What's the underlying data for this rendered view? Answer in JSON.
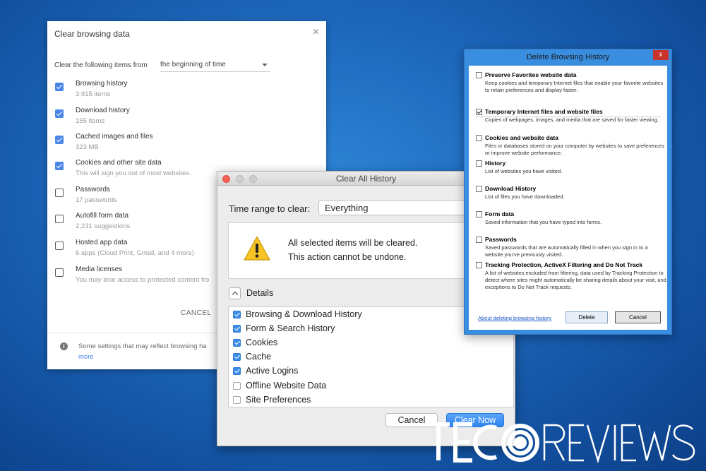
{
  "chrome": {
    "title": "Clear browsing data",
    "close": "×",
    "from_label": "Clear the following items from",
    "range": "the beginning of time",
    "items": [
      {
        "label": "Browsing history",
        "sub": "3,915 items",
        "checked": true
      },
      {
        "label": "Download history",
        "sub": "155 items",
        "checked": true
      },
      {
        "label": "Cached images and files",
        "sub": "323 MB",
        "checked": true
      },
      {
        "label": "Cookies and other site data",
        "sub": "This will sign you out of most websites.",
        "checked": true
      },
      {
        "label": "Passwords",
        "sub": "17 passwords",
        "checked": false
      },
      {
        "label": "Autofill form data",
        "sub": "2,231 suggestions",
        "checked": false
      },
      {
        "label": "Hosted app data",
        "sub": "6 apps (Cloud Print, Gmail, and 4 more)",
        "checked": false
      },
      {
        "label": "Media licenses",
        "sub": "You may lose access to protected content fro",
        "checked": false
      }
    ],
    "cancel": "CANCEL",
    "footer": "Some settings that may reflect browsing ha",
    "more": "more",
    "accent": "#4a86e8"
  },
  "safari": {
    "title": "Clear All History",
    "time_range_label": "Time range to clear:",
    "time_range_value": "Everything",
    "message_line1": "All selected items will be cleared.",
    "message_line2": "This action cannot be undone.",
    "details_label": "Details",
    "items": [
      {
        "label": "Browsing & Download History",
        "checked": true
      },
      {
        "label": "Form & Search History",
        "checked": true
      },
      {
        "label": "Cookies",
        "checked": true
      },
      {
        "label": "Cache",
        "checked": true
      },
      {
        "label": "Active Logins",
        "checked": true
      },
      {
        "label": "Offline Website Data",
        "checked": false
      },
      {
        "label": "Site Preferences",
        "checked": false
      }
    ],
    "cancel": "Cancel",
    "clear_now": "Clear Now"
  },
  "ie": {
    "title": "Delete Browsing History",
    "close": "x",
    "items": [
      {
        "label": "Preserve Favorites website data",
        "desc": "Keep cookies and temporary Internet files that enable your favorite websites to retain preferences and display faster.",
        "checked": false
      },
      {
        "label": "Temporary Internet files and website files",
        "desc": "Copies of webpages, images, and media that are saved for faster viewing.",
        "checked": true
      },
      {
        "label": "Cookies and website data",
        "desc": "Files or databases stored on your computer by websites to save preferences or improve website performance.",
        "checked": false
      },
      {
        "label": "History",
        "desc": "List of websites you have visited.",
        "checked": false
      },
      {
        "label": "Download History",
        "desc": "List of files you have downloaded.",
        "checked": false
      },
      {
        "label": "Form data",
        "desc": "Saved information that you have typed into forms.",
        "checked": false
      },
      {
        "label": "Passwords",
        "desc": "Saved passwords that are automatically filled in when you sign in to a website you've previously visited.",
        "checked": false
      },
      {
        "label": "Tracking Protection, ActiveX Filtering and Do Not Track",
        "desc": "A list of websites excluded from filtering, data used by Tracking Protection to detect where sites might automatically be sharing details about your visit, and exceptions to Do Not Track requests.",
        "checked": false
      }
    ],
    "about_link": "About deleting browsing history",
    "delete": "Delete",
    "cancel": "Cancel"
  },
  "watermark": {
    "text": "TECOREVIEWS"
  }
}
